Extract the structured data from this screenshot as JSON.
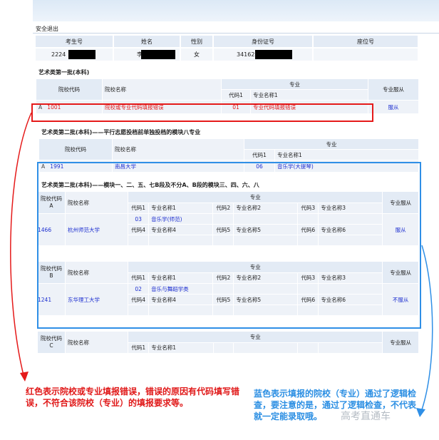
{
  "header": {
    "logout": "安全退出"
  },
  "student": {
    "headers": [
      "考生号",
      "姓名",
      "性别",
      "身份证号",
      "座位号"
    ],
    "values": [
      "2224",
      "李",
      "女",
      "341623",
      ""
    ]
  },
  "section1": {
    "title": "艺术类第一批(本科)",
    "h_school_code": "院校代码",
    "h_school_name": "院校名称",
    "h_major": "专业",
    "h_code1": "代码1",
    "h_major_name1": "专业名称1",
    "h_obey": "专业服从",
    "row": {
      "prefix": "A",
      "code": "1001",
      "school": "院校或专业代码填报错误",
      "major_code": "01",
      "major_name": "专业代码填报错误",
      "obey": "服从"
    }
  },
  "section2": {
    "title": "艺术类第二批(本科)——平行志愿投档前单独投档的模块八专业",
    "h_school_code": "院校代码",
    "h_school_name": "院校名称",
    "h_major": "专业",
    "h_code1": "代码1",
    "h_major_name1": "专业名称1",
    "row": {
      "prefix": "A",
      "code": "1991",
      "school": "南昌大学",
      "major_code": "06",
      "major_name": "音乐学(大提琴)"
    }
  },
  "section3": {
    "title": "艺术类第二批(本科)——模块一、二、五、七B段及不分A、B段的模块三、四、六、八",
    "labels": {
      "school_code": "院校代码",
      "school_name": "院校名称",
      "major": "专业",
      "obey": "专业服从",
      "code1": "代码1",
      "name1": "专业名称1",
      "code2": "代码2",
      "name2": "专业名称2",
      "code3": "代码3",
      "name3": "专业名称3",
      "code4": "代码4",
      "name4": "专业名称4",
      "code5": "代码5",
      "name5": "专业名称5",
      "code6": "代码6",
      "name6": "专业名称6"
    },
    "blockA": {
      "letter": "A",
      "code": "1466",
      "school": "杭州师范大学",
      "major_code": "03",
      "major_name": "音乐学(师范)",
      "obey": "服从"
    },
    "blockB": {
      "letter": "B",
      "code": "1241",
      "school": "东华理工大学",
      "major_code": "02",
      "major_name": "音乐与舞蹈学类",
      "obey": "不服从"
    },
    "blockC": {
      "letter": "C"
    }
  },
  "annotations": {
    "red_note": "红色表示院校或专业填报错误，错误的原因有代码填写错误，不符合该院校（专业）的填报要求等。",
    "blue_note": "蓝色表示填报的院校（专业）通过了逻辑检查，要注意的是，通过了逻辑检查，不代表就一定能录取哦。",
    "watermark": "高考直通车"
  },
  "colors": {
    "red": "#e01818",
    "blue_box": "#2f8fe6",
    "link_blue": "#1d2fd0"
  }
}
